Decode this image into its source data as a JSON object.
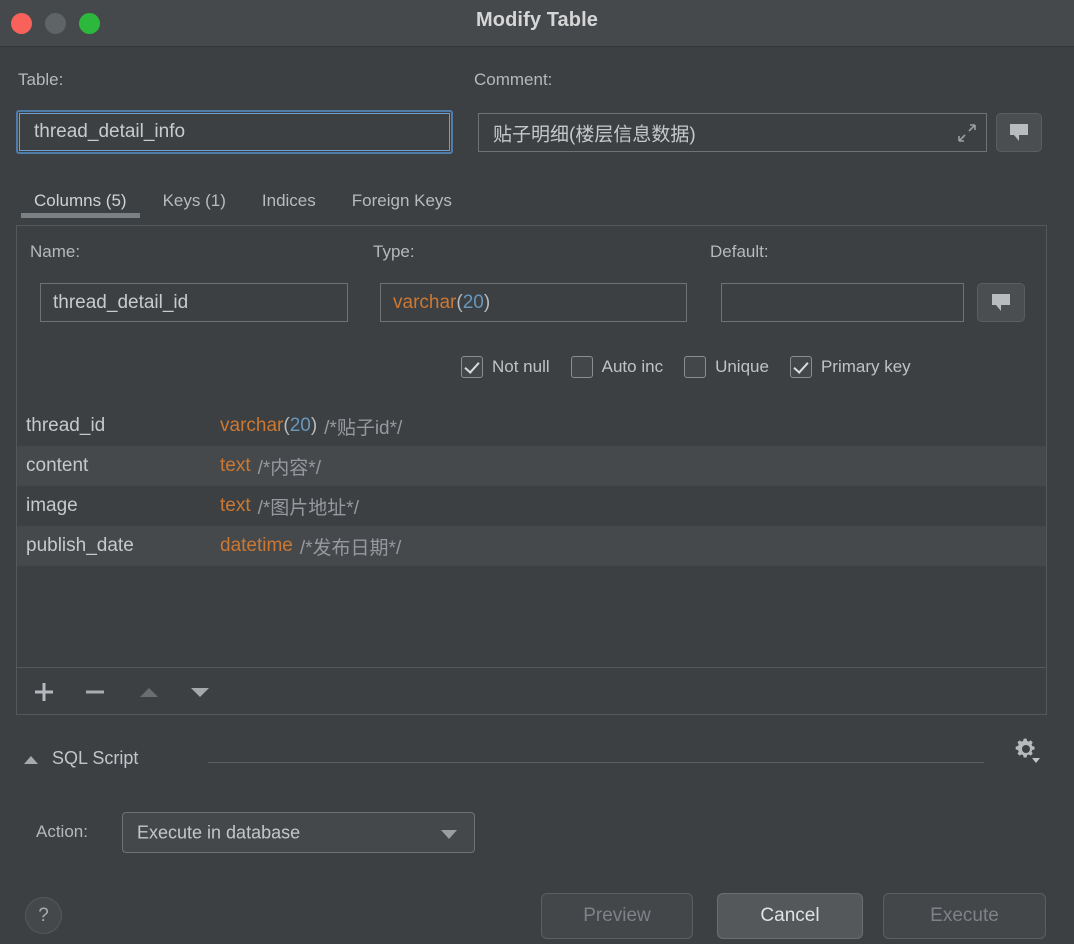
{
  "window": {
    "title": "Modify Table",
    "traffic_lights": [
      "close",
      "minimize",
      "maximize"
    ],
    "colors": {
      "close": "#f9625b",
      "minimize": "#5f6467",
      "maximize": "#2cb83c",
      "background": "#3c4043",
      "titlebar": "#46494c",
      "focus_accent": "#6a9fd0",
      "type_token": "#cc7832",
      "number_token": "#6897bb",
      "comment_token": "#969a9e"
    }
  },
  "top": {
    "table_label": "Table:",
    "table_value": "thread_detail_info",
    "table_placeholder": "",
    "comment_label": "Comment:",
    "comment_value": "贴子明细(楼层信息数据)",
    "comment_placeholder": "",
    "expand_icon": "expand-diagonal-icon",
    "comment_button_icon": "speech-bubble-icon"
  },
  "tabs": [
    {
      "label": "Columns (5)",
      "active": true
    },
    {
      "label": "Keys (1)",
      "active": false
    },
    {
      "label": "Indices",
      "active": false
    },
    {
      "label": "Foreign Keys",
      "active": false
    }
  ],
  "editor": {
    "name_label": "Name:",
    "name_value": "thread_detail_id",
    "type_label": "Type:",
    "type_value": "varchar(20)",
    "type_base": "varchar",
    "type_paren_open": "(",
    "type_length": "20",
    "type_paren_close": ")",
    "default_label": "Default:",
    "default_value": "",
    "default_comment_button_icon": "speech-bubble-icon",
    "checkboxes": [
      {
        "label": "Not null",
        "checked": true
      },
      {
        "label": "Auto inc",
        "checked": false
      },
      {
        "label": "Unique",
        "checked": false
      },
      {
        "label": "Primary key",
        "checked": true
      }
    ]
  },
  "columns": [
    {
      "name": "thread_id",
      "type": "varchar",
      "paren_open": "(",
      "length": "20",
      "paren_close": ")",
      "comment": "/*贴子id*/",
      "striped": false
    },
    {
      "name": "content",
      "type": "text",
      "paren_open": "",
      "length": "",
      "paren_close": "",
      "comment": "/*内容*/",
      "striped": true
    },
    {
      "name": "image",
      "type": "text",
      "paren_open": "",
      "length": "",
      "paren_close": "",
      "comment": "/*图片地址*/",
      "striped": false
    },
    {
      "name": "publish_date",
      "type": "datetime",
      "paren_open": "",
      "length": "",
      "paren_close": "",
      "comment": "/*发布日期*/",
      "striped": true
    }
  ],
  "list_toolbar": [
    {
      "name": "add-column-button",
      "icon": "plus-icon",
      "enabled": true
    },
    {
      "name": "remove-column-button",
      "icon": "minus-icon",
      "enabled": true
    },
    {
      "name": "move-column-up-button",
      "icon": "arrow-up-icon",
      "enabled": false
    },
    {
      "name": "move-column-down-button",
      "icon": "arrow-down-icon",
      "enabled": true
    }
  ],
  "sql_section": {
    "title": "SQL Script",
    "expanded": true,
    "twisty_icon": "chevron-up-icon",
    "settings_icon": "gear-icon",
    "action_label": "Action:",
    "action_value": "Execute in database",
    "action_options": [
      "Execute in database"
    ]
  },
  "footer": {
    "help_label": "?",
    "buttons": [
      {
        "label": "Preview",
        "enabled": false
      },
      {
        "label": "Cancel",
        "enabled": true
      },
      {
        "label": "Execute",
        "enabled": false
      }
    ]
  }
}
